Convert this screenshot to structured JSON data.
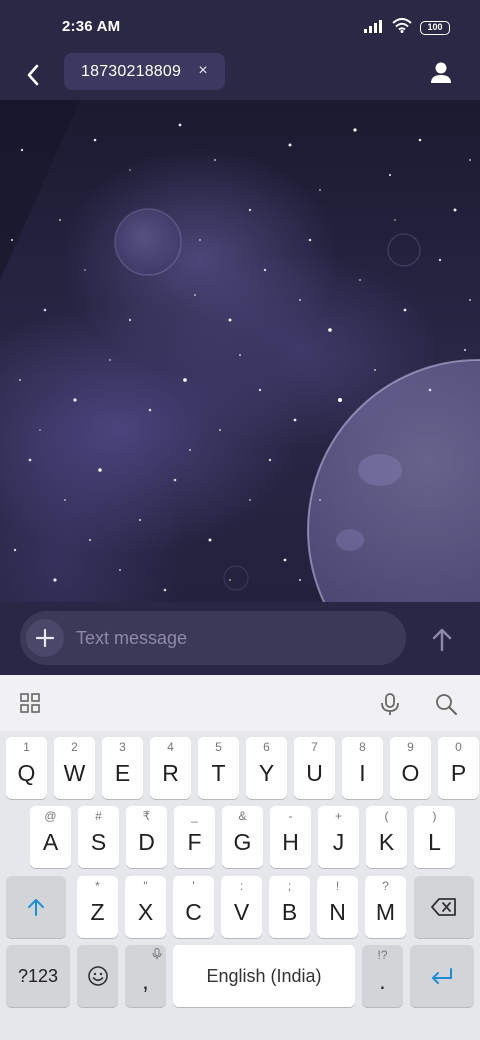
{
  "status_bar": {
    "time": "2:36 AM",
    "battery": "100",
    "icons": [
      "signal-icon",
      "wifi-icon",
      "battery-icon"
    ]
  },
  "header": {
    "back_icon": "back-arrow-icon",
    "recipient": "18730218809",
    "remove_recipient": "×",
    "contact_icon": "contact-icon"
  },
  "compose": {
    "placeholder": "Text message",
    "attach_icon": "plus-icon",
    "send_icon": "send-arrow-icon"
  },
  "keyboard": {
    "toolbar": [
      "apps-grid-icon",
      "microphone-icon",
      "search-icon"
    ],
    "row1": [
      {
        "main": "Q",
        "hint": "1"
      },
      {
        "main": "W",
        "hint": "2"
      },
      {
        "main": "E",
        "hint": "3"
      },
      {
        "main": "R",
        "hint": "4"
      },
      {
        "main": "T",
        "hint": "5"
      },
      {
        "main": "Y",
        "hint": "6"
      },
      {
        "main": "U",
        "hint": "7"
      },
      {
        "main": "I",
        "hint": "8"
      },
      {
        "main": "O",
        "hint": "9"
      },
      {
        "main": "P",
        "hint": "0"
      }
    ],
    "row2": [
      {
        "main": "A",
        "hint": "@"
      },
      {
        "main": "S",
        "hint": "#"
      },
      {
        "main": "D",
        "hint": "₹"
      },
      {
        "main": "F",
        "hint": "_"
      },
      {
        "main": "G",
        "hint": "&"
      },
      {
        "main": "H",
        "hint": "-"
      },
      {
        "main": "J",
        "hint": "+"
      },
      {
        "main": "K",
        "hint": "("
      },
      {
        "main": "L",
        "hint": ")"
      }
    ],
    "row3": [
      {
        "main": "Z",
        "hint": "*"
      },
      {
        "main": "X",
        "hint": "\""
      },
      {
        "main": "C",
        "hint": "'"
      },
      {
        "main": "V",
        "hint": ":"
      },
      {
        "main": "B",
        "hint": ";"
      },
      {
        "main": "N",
        "hint": "!"
      },
      {
        "main": "M",
        "hint": "?"
      }
    ],
    "symbols_label": "?123",
    "comma": ",",
    "space_label": "English (India)",
    "period": ".",
    "period_hint": "!?",
    "accent_color": "#1a8fd6"
  }
}
